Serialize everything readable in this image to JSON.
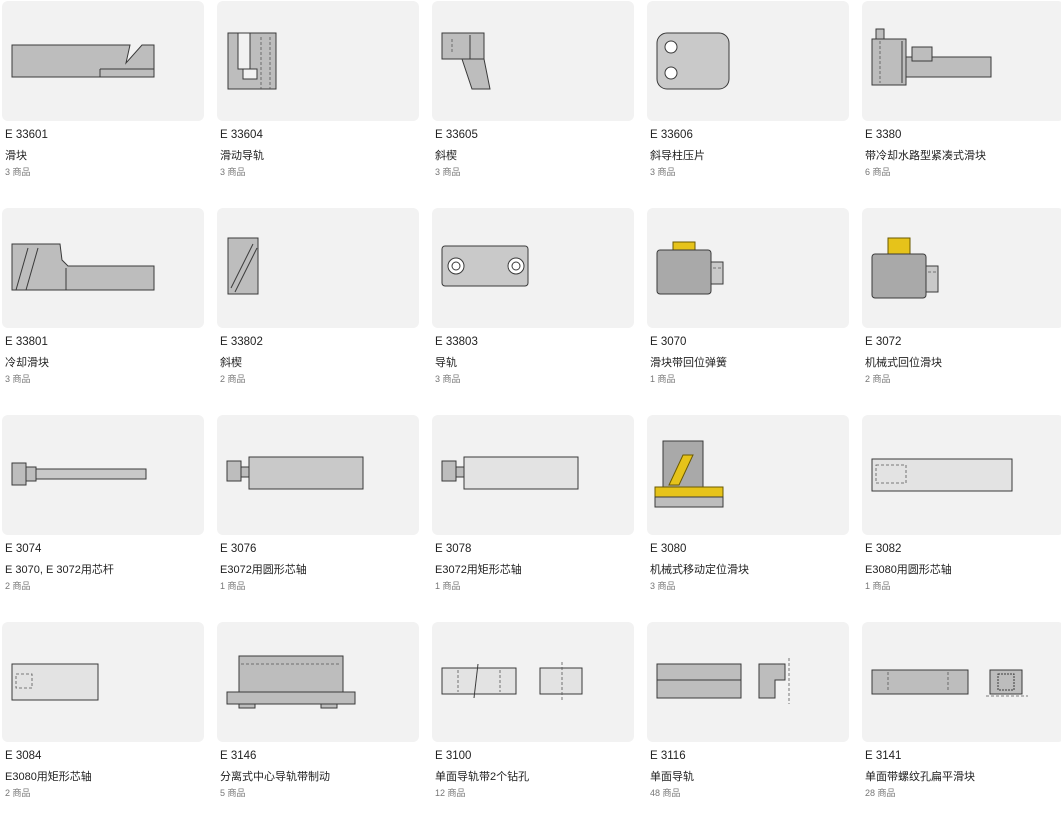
{
  "products": [
    {
      "code": "E 33601",
      "name": "滑块",
      "count": "3 商品",
      "icon": "slider-block-icon"
    },
    {
      "code": "E 33604",
      "name": "滑动导轨",
      "count": "3 商品",
      "icon": "sliding-guide-icon"
    },
    {
      "code": "E 33605",
      "name": "斜楔",
      "count": "3 商品",
      "icon": "angled-wedge-icon"
    },
    {
      "code": "E 33606",
      "name": "斜导柱压片",
      "count": "3 商品",
      "icon": "angle-pin-plate-icon"
    },
    {
      "code": "E 3380",
      "name": "带冷却水路型紧凑式滑块",
      "count": "6 商品",
      "icon": "compact-cooled-slider-icon"
    },
    {
      "code": "E 33801",
      "name": "冷却滑块",
      "count": "3 商品",
      "icon": "cooling-slider-icon"
    },
    {
      "code": "E 33802",
      "name": "斜楔",
      "count": "2 商品",
      "icon": "wedge-block-icon"
    },
    {
      "code": "E 33803",
      "name": "导轨",
      "count": "3 商品",
      "icon": "guide-rail-icon"
    },
    {
      "code": "E 3070",
      "name": "滑块带回位弹簧",
      "count": "1 商品",
      "icon": "spring-return-slider-icon"
    },
    {
      "code": "E 3072",
      "name": "机械式回位滑块",
      "count": "2 商品",
      "icon": "mechanical-return-slider-icon"
    },
    {
      "code": "E 3074",
      "name": "E 3070, E 3072用芯杆",
      "count": "2 商品",
      "icon": "core-rod-icon"
    },
    {
      "code": "E 3076",
      "name": "E3072用圆形芯轴",
      "count": "1 商品",
      "icon": "round-mandrel-icon"
    },
    {
      "code": "E 3078",
      "name": "E3072用矩形芯轴",
      "count": "1 商品",
      "icon": "rectangular-mandrel-icon"
    },
    {
      "code": "E 3080",
      "name": "机械式移动定位滑块",
      "count": "3 商品",
      "icon": "positioning-slider-icon"
    },
    {
      "code": "E 3082",
      "name": "E3080用圆形芯轴",
      "count": "1 商品",
      "icon": "round-mandrel-long-icon"
    },
    {
      "code": "E 3084",
      "name": "E3080用矩形芯轴",
      "count": "2 商品",
      "icon": "rectangular-mandrel-short-icon"
    },
    {
      "code": "E 3146",
      "name": "分离式中心导轨带制动",
      "count": "5 商品",
      "icon": "center-guide-brake-icon"
    },
    {
      "code": "E 3100",
      "name": "单面导轨带2个钻孔",
      "count": "12 商品",
      "icon": "guide-two-holes-icon"
    },
    {
      "code": "E 3116",
      "name": "单面导轨",
      "count": "48 商品",
      "icon": "single-guide-icon"
    },
    {
      "code": "E 3141",
      "name": "单面带螺纹孔扁平滑块",
      "count": "28 商品",
      "icon": "threaded-flat-slider-icon"
    }
  ],
  "colors": {
    "card_bg": "#f2f2f2",
    "part_fill": "#bcbcbc",
    "part_stroke": "#3a3a3a",
    "accent_yellow": "#e6c31a"
  }
}
